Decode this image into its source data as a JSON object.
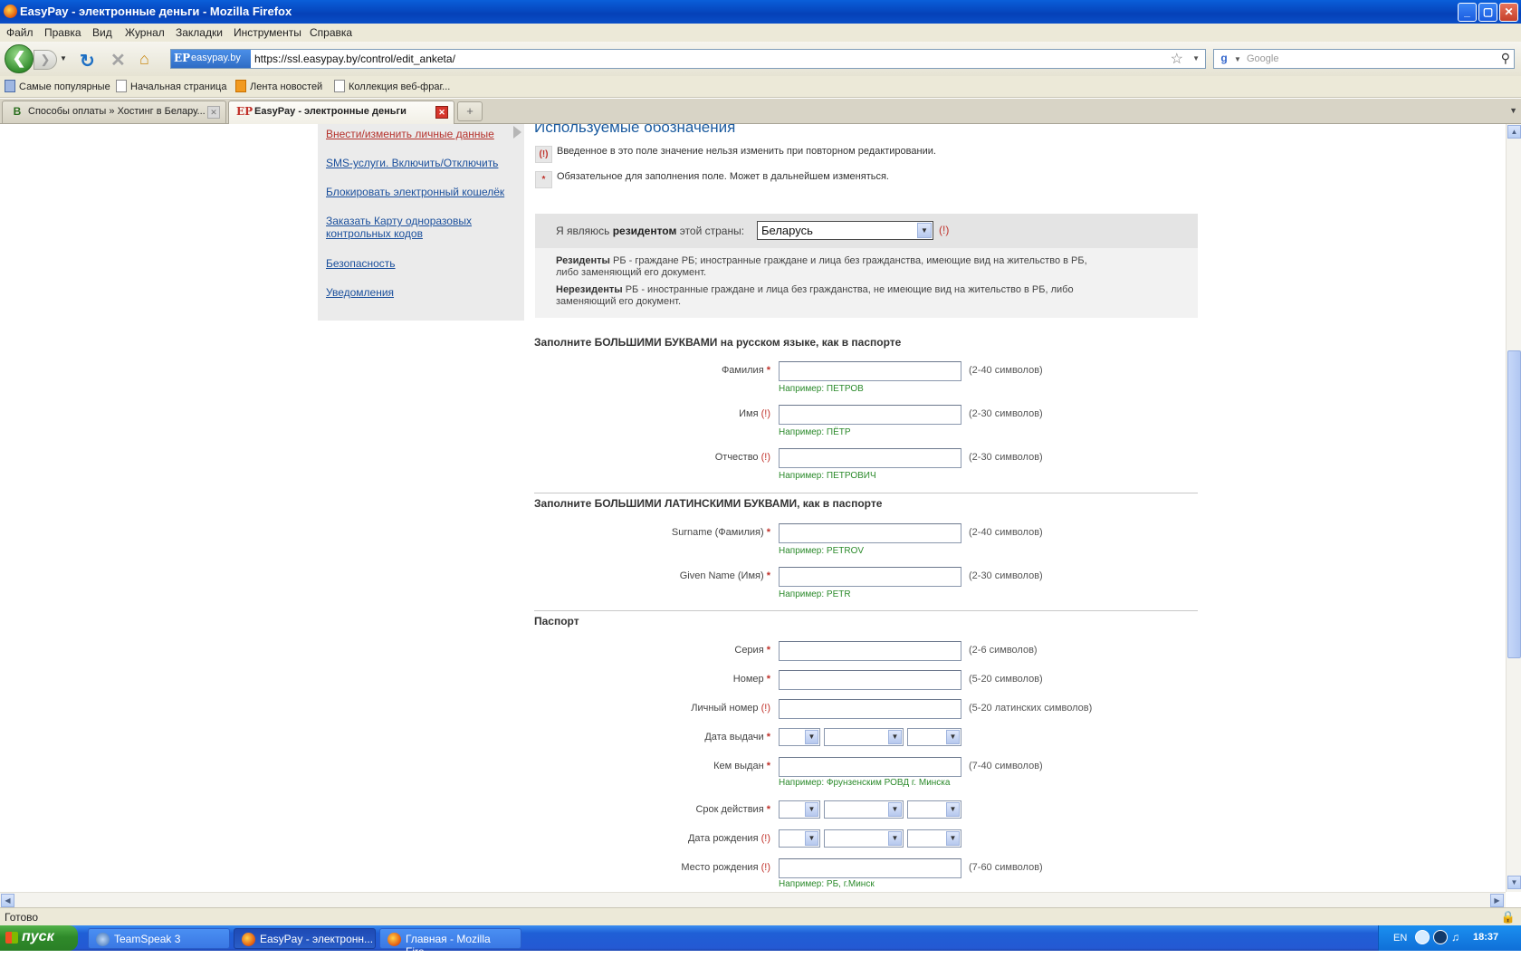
{
  "window": {
    "title": "EasyPay - электронные деньги - Mozilla Firefox",
    "buttons": [
      "_",
      "▢",
      "✕"
    ]
  },
  "menu": [
    "Файл",
    "Правка",
    "Вид",
    "Журнал",
    "Закладки",
    "Инструменты",
    "Справка"
  ],
  "nav": {
    "site_badge": "easypay.by",
    "site_icon": "EP",
    "url": "https://ssl.easypay.by/control/edit_anketa/",
    "search_placeholder": "Google",
    "search_icon": "g"
  },
  "bookmarks": [
    "Самые популярные",
    "Начальная страница",
    "Лента новостей",
    "Коллекция веб-фраг..."
  ],
  "tabs": [
    {
      "label": "Способы оплаты » Хостинг в Белару...",
      "icon": "B",
      "active": false
    },
    {
      "label": "EasyPay - электронные деньги",
      "icon": "EP",
      "active": true
    }
  ],
  "sidebar": {
    "items": [
      "Внести/изменить личные данные",
      "SMS-услуги. Включить/Отключить",
      "Блокировать электронный кошелёк",
      "Заказать Карту одноразовых контрольных кодов",
      "Безопасность",
      "Уведомления"
    ]
  },
  "legend": {
    "title": "Используемые обозначения",
    "badge_fixed": "(!)",
    "text_fixed": "Введенное в это поле значение нельзя изменить при повторном редактировании.",
    "badge_required": "*",
    "text_required": "Обязательное для заполнения поле. Может в дальнейшем изменяться."
  },
  "resident": {
    "label_pre": "Я являюсь",
    "label_bold": "резидентом",
    "label_post": "этой страны:",
    "country": "Беларусь",
    "mark": "(!)",
    "note1_bold": "Резиденты",
    "note1_text": " РБ - граждане РБ; иностранные граждане и лица без гражданства, имеющие вид на жительство в РБ, либо заменяющий его документ.",
    "note2_bold": "Нерезиденты",
    "note2_text": " РБ - иностранные граждане и лица без гражданства, не имеющие вид на жительство в РБ, либо заменяющий его документ."
  },
  "sections": {
    "russian": "Заполните БОЛЬШИМИ БУКВАМИ на русском языке, как в паспорте",
    "latin": "Заполните БОЛЬШИМИ ЛАТИНСКИМИ БУКВАМИ, как в паспорте",
    "passport": "Паспорт"
  },
  "fields": {
    "surname": {
      "label": "Фамилия",
      "mark": "*",
      "hint": "(2-40 символов)",
      "example": "Например: ПЕТРОВ"
    },
    "name": {
      "label": "Имя",
      "mark": "(!)",
      "hint": "(2-30 символов)",
      "example": "Например: ПЁТР"
    },
    "patronymic": {
      "label": "Отчество",
      "mark": "(!)",
      "hint": "(2-30 символов)",
      "example": "Например: ПЕТРОВИЧ"
    },
    "surname_lat": {
      "label": "Surname (Фамилия)",
      "mark": "*",
      "hint": "(2-40 символов)",
      "example": "Например: PETROV"
    },
    "given_lat": {
      "label": "Given Name (Имя)",
      "mark": "*",
      "hint": "(2-30 символов)",
      "example": "Например: PETR"
    },
    "series": {
      "label": "Серия",
      "mark": "*",
      "hint": "(2-6 символов)"
    },
    "number": {
      "label": "Номер",
      "mark": "*",
      "hint": "(5-20 символов)"
    },
    "personal": {
      "label": "Личный номер",
      "mark": "(!)",
      "hint": "(5-20 латинских символов)"
    },
    "issue_date": {
      "label": "Дата выдачи",
      "mark": "*"
    },
    "issued_by": {
      "label": "Кем выдан",
      "mark": "*",
      "hint": "(7-40 символов)",
      "example": "Например: Фрунзенским РОВД г. Минска"
    },
    "valid_until": {
      "label": "Срок действия",
      "mark": "*"
    },
    "birth_date": {
      "label": "Дата рождения",
      "mark": "(!)"
    },
    "birth_place": {
      "label": "Место рождения",
      "mark": "(!)",
      "hint": "(7-60 символов)",
      "example": "Например: РБ, г.Минск"
    }
  },
  "status": "Готово",
  "taskbar": {
    "start": "пуск",
    "tasks": [
      "TeamSpeak 3",
      "EasyPay - электронн...",
      "Главная - Mozilla Fire..."
    ],
    "lang": "EN",
    "clock": "18:37"
  }
}
